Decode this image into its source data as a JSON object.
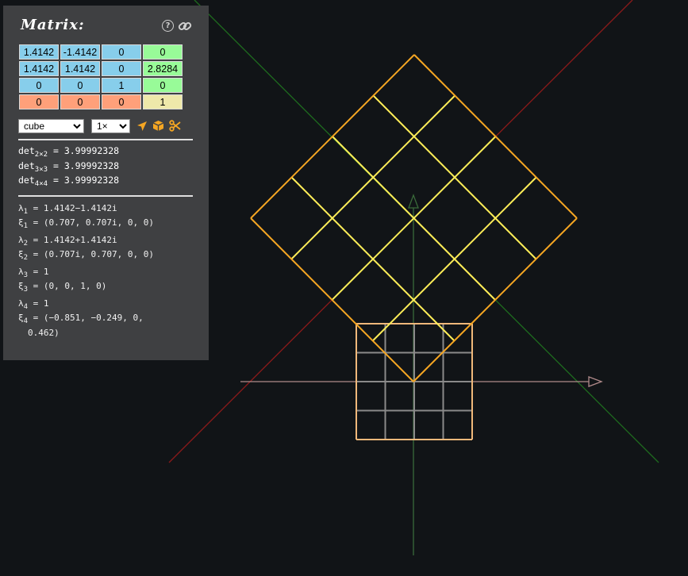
{
  "panel": {
    "title": "Matrix:",
    "matrix_rows": [
      [
        "1.4142",
        "-1.4142",
        "0",
        "0"
      ],
      [
        "1.4142",
        "1.4142",
        "0",
        "2.8284"
      ],
      [
        "0",
        "0",
        "1",
        "0"
      ],
      [
        "0",
        "0",
        "0",
        "1"
      ]
    ],
    "colors": {
      "linear": "#87ceeb",
      "translation": "#98fb98",
      "perspective": "#ffa07a",
      "homogeneous": "#eee8aa"
    },
    "shape_select": "cube",
    "scale_select": "1×",
    "icons": [
      "help-icon",
      "link-icon",
      "arrow-tool-icon",
      "cube-tool-icon",
      "scissors-icon"
    ],
    "det": [
      {
        "label": "det",
        "sub": "2×2",
        "value": "= 3.99992328"
      },
      {
        "label": "det",
        "sub": "3×3",
        "value": "= 3.99992328"
      },
      {
        "label": "det",
        "sub": "4×4",
        "value": "= 3.99992328"
      }
    ],
    "eigen": [
      {
        "lambda": "= 1.4142−1.4142i",
        "xi": "= (0.707, 0.707i, 0, 0)"
      },
      {
        "lambda": "= 1.4142+1.4142i",
        "xi": "= (0.707i, 0.707, 0, 0)"
      },
      {
        "lambda": "= 1",
        "xi": "= (0, 0, 1, 0)"
      },
      {
        "lambda": "= 1",
        "xi": "= (−0.851, −0.249, 0,",
        "xi_cont": "0.462)"
      }
    ],
    "symbols": {
      "lambda": "λ",
      "xi": "ξ"
    },
    "eigen_subs": [
      "1",
      "2",
      "3",
      "4"
    ]
  },
  "scene": {
    "colors": {
      "background": "#111417",
      "transformed_grid": "#ffee58",
      "transformed_edge": "#f5a623",
      "original_grid": "#8a8a8a",
      "original_edge": "#f0b87a",
      "axis_x": "#b08a8a",
      "axis_y": "#3a6a3a",
      "eigen_red": "#8b1a1a",
      "eigen_green": "#1e6b1e"
    }
  }
}
